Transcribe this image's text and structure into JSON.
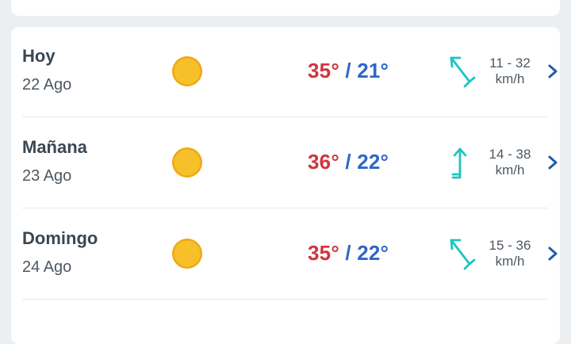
{
  "forecast": [
    {
      "day": "Hoy",
      "date": "22 Ago",
      "icon": "sun-icon",
      "max": "35°",
      "separator": "/",
      "min": "21°",
      "wind_icon": "wind-arrow-northwest-icon",
      "wind_range": "11 - 32",
      "wind_unit": "km/h"
    },
    {
      "day": "Mañana",
      "date": "23 Ago",
      "icon": "sun-icon",
      "max": "36°",
      "separator": "/",
      "min": "22°",
      "wind_icon": "wind-arrow-north-icon",
      "wind_range": "14 - 38",
      "wind_unit": "km/h"
    },
    {
      "day": "Domingo",
      "date": "24 Ago",
      "icon": "sun-icon",
      "max": "35°",
      "separator": "/",
      "min": "22°",
      "wind_icon": "wind-arrow-northwest-icon",
      "wind_range": "15 - 36",
      "wind_unit": "km/h"
    }
  ],
  "colors": {
    "max_temp": "#d0343f",
    "min_temp": "#2f66c7",
    "wind_icon": "#1fc4c4",
    "chevron": "#1d5fa5",
    "sun": "#f3b51d"
  }
}
